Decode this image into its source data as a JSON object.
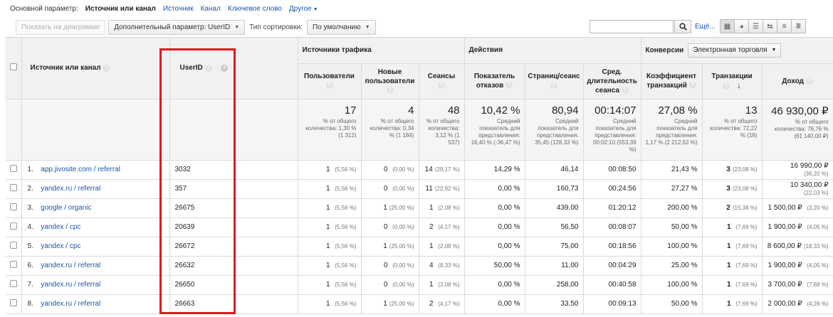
{
  "dimensions": {
    "label": "Основной параметр:",
    "active": "Источник или канал",
    "links": [
      "Источник",
      "Канал",
      "Ключевое слово",
      "Другое"
    ]
  },
  "toolbar": {
    "plot_button": "Показать на диаграмме",
    "secondary_dim": "Дополнительный параметр: UserID",
    "sort_label": "Тип сортировки:",
    "sort_value": "По умолчанию",
    "search_value": "",
    "more_link": "Ещё...",
    "view_icons": [
      "table-view-icon",
      "pie-view-icon",
      "performance-view-icon",
      "comparison-view-icon",
      "term-cloud-icon",
      "pivot-view-icon"
    ]
  },
  "header": {
    "col_source": "Источник или канал",
    "col_userid": "UserID",
    "group_traffic": "Источники трафика",
    "group_actions": "Действия",
    "group_conversions": "Конверсии",
    "conversion_select": "Электронная торговля",
    "metrics": [
      "Пользователи",
      "Новые пользователи",
      "Сеансы",
      "Показатель отказов",
      "Страниц/сеанс",
      "Сред. длительность сеанса",
      "Коэффициент транзакций",
      "Транзакции",
      "Доход"
    ]
  },
  "summary": [
    {
      "value": "17",
      "note": "% от общего количества: 1,30 % (1 312)"
    },
    {
      "value": "4",
      "note": "% от общего количества: 0,34 % (1 184)"
    },
    {
      "value": "48",
      "note": "% от общего количества: 3,12 % (1 537)"
    },
    {
      "value": "10,42 %",
      "note": "Средний показатель для представления: 16,40 % (-36,47 %)"
    },
    {
      "value": "80,94",
      "note": "Средний показатель для представления: 35,45 (128,33 %)"
    },
    {
      "value": "00:14:07",
      "note": "Средний показатель для представления: 00:02:10 (553,39 %)"
    },
    {
      "value": "27,08 %",
      "note": "Средний показатель для представления: 1,17 % (2 212,62 %)"
    },
    {
      "value": "13",
      "note": "% от общего количества: 72,22 % (18)"
    },
    {
      "value": "46 930,00 ₽",
      "note": "% от общего количества: 76,76 % (61 140,00 ₽)"
    }
  ],
  "rows": [
    {
      "n": "1.",
      "source": "app.jivosite.com / referral",
      "userid": "3032",
      "users": "1",
      "users_pct": "(5,56 %)",
      "new": "0",
      "new_pct": "(0,00 %)",
      "sessions": "14",
      "sessions_pct": "(29,17 %)",
      "bounce": "14,29 %",
      "pages": "46,14",
      "duration": "00:08:50",
      "conv": "21,43 %",
      "tx": "3",
      "tx_pct": "(23,08 %)",
      "revenue": "16 990,00 ₽",
      "revenue_pct": "(36,20 %)"
    },
    {
      "n": "2.",
      "source": "yandex.ru / referral",
      "userid": "357",
      "users": "1",
      "users_pct": "(5,56 %)",
      "new": "0",
      "new_pct": "(0,00 %)",
      "sessions": "11",
      "sessions_pct": "(22,92 %)",
      "bounce": "0,00 %",
      "pages": "160,73",
      "duration": "00:24:56",
      "conv": "27,27 %",
      "tx": "3",
      "tx_pct": "(23,08 %)",
      "revenue": "10 340,00 ₽",
      "revenue_pct": "(22,03 %)"
    },
    {
      "n": "3.",
      "source": "google / organic",
      "userid": "26675",
      "users": "1",
      "users_pct": "(5,56 %)",
      "new": "1",
      "new_pct": "(25,00 %)",
      "sessions": "1",
      "sessions_pct": "(2,08 %)",
      "bounce": "0,00 %",
      "pages": "439,00",
      "duration": "01:20:12",
      "conv": "200,00 %",
      "tx": "2",
      "tx_pct": "(15,38 %)",
      "revenue": "1 500,00 ₽",
      "revenue_pct": "(3,20 %)"
    },
    {
      "n": "4.",
      "source": "yandex / cpc",
      "userid": "20639",
      "users": "1",
      "users_pct": "(5,56 %)",
      "new": "0",
      "new_pct": "(0,00 %)",
      "sessions": "2",
      "sessions_pct": "(4,17 %)",
      "bounce": "0,00 %",
      "pages": "56,50",
      "duration": "00:08:07",
      "conv": "50,00 %",
      "tx": "1",
      "tx_pct": "(7,69 %)",
      "revenue": "1 900,00 ₽",
      "revenue_pct": "(4,05 %)"
    },
    {
      "n": "5.",
      "source": "yandex / cpc",
      "userid": "26672",
      "users": "1",
      "users_pct": "(5,56 %)",
      "new": "1",
      "new_pct": "(25,00 %)",
      "sessions": "1",
      "sessions_pct": "(2,08 %)",
      "bounce": "0,00 %",
      "pages": "75,00",
      "duration": "00:18:56",
      "conv": "100,00 %",
      "tx": "1",
      "tx_pct": "(7,69 %)",
      "revenue": "8 600,00 ₽",
      "revenue_pct": "(18,33 %)"
    },
    {
      "n": "6.",
      "source": "yandex.ru / referral",
      "userid": "26632",
      "users": "1",
      "users_pct": "(5,56 %)",
      "new": "0",
      "new_pct": "(0,00 %)",
      "sessions": "4",
      "sessions_pct": "(8,33 %)",
      "bounce": "50,00 %",
      "pages": "11,00",
      "duration": "00:04:29",
      "conv": "25,00 %",
      "tx": "1",
      "tx_pct": "(7,69 %)",
      "revenue": "1 900,00 ₽",
      "revenue_pct": "(4,05 %)"
    },
    {
      "n": "7.",
      "source": "yandex.ru / referral",
      "userid": "26650",
      "users": "1",
      "users_pct": "(5,56 %)",
      "new": "0",
      "new_pct": "(0,00 %)",
      "sessions": "1",
      "sessions_pct": "(2,08 %)",
      "bounce": "0,00 %",
      "pages": "258,00",
      "duration": "00:40:58",
      "conv": "100,00 %",
      "tx": "1",
      "tx_pct": "(7,69 %)",
      "revenue": "3 700,00 ₽",
      "revenue_pct": "(7,88 %)"
    },
    {
      "n": "8.",
      "source": "yandex.ru / referral",
      "userid": "26663",
      "users": "1",
      "users_pct": "(5,56 %)",
      "new": "1",
      "new_pct": "(25,00 %)",
      "sessions": "2",
      "sessions_pct": "(4,17 %)",
      "bounce": "0,00 %",
      "pages": "33,50",
      "duration": "00:09:13",
      "conv": "50,00 %",
      "tx": "1",
      "tx_pct": "(7,69 %)",
      "revenue": "2 000,00 ₽",
      "revenue_pct": "(4,26 %)"
    }
  ],
  "colors": {
    "link": "#1a57a8",
    "highlight": "#e0181d",
    "header_bg": "#f1f1f1"
  }
}
